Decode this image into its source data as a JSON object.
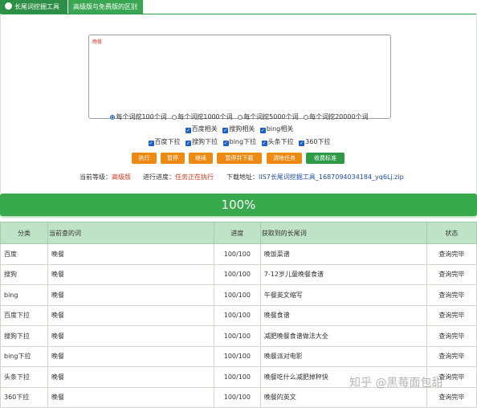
{
  "tabs": [
    {
      "label": "长尾词挖掘工具"
    },
    {
      "label": "高级版与免费版的区别"
    }
  ],
  "keyword_input": {
    "value": "晚餐"
  },
  "radio_options": [
    {
      "label": "每个词挖100个词",
      "checked": true
    },
    {
      "label": "每个词挖1000个词",
      "checked": false
    },
    {
      "label": "每个词挖5000个词",
      "checked": false
    },
    {
      "label": "每个词挖20000个词",
      "checked": false
    }
  ],
  "related_checks": [
    {
      "label": "百度相关",
      "checked": true
    },
    {
      "label": "搜狗相关",
      "checked": true
    },
    {
      "label": "bing相关",
      "checked": true
    }
  ],
  "dropdown_checks": [
    {
      "label": "百度下拉",
      "checked": true
    },
    {
      "label": "搜狗下拉",
      "checked": true
    },
    {
      "label": "bing下拉",
      "checked": true
    },
    {
      "label": "头条下拉",
      "checked": true
    },
    {
      "label": "360下拉",
      "checked": true
    }
  ],
  "buttons": {
    "execute": "执行",
    "pause": "暂停",
    "continue": "继续",
    "pause_download": "暂停并下载",
    "clear": "清除任务",
    "pricing": "收费标准"
  },
  "status": {
    "level_label": "当前等级：",
    "level_value": "高级版",
    "progress_label": "进行进度：",
    "progress_value": "任务正在执行",
    "download_label": "下载地址：",
    "download_link": "IIS7长尾词挖掘工具_1687094034184_yq6Lj.zip"
  },
  "progress_bar": {
    "text": "100%",
    "percent": 100,
    "color": "#39a94d"
  },
  "table": {
    "headers": [
      "分类",
      "当前查的词",
      "进度",
      "获取到的长尾词",
      "状态"
    ],
    "rows": [
      [
        "百度",
        "晚餐",
        "100/100",
        "晚饭菜谱",
        "查询完毕"
      ],
      [
        "搜狗",
        "晚餐",
        "100/100",
        "7-12岁儿童晚餐食谱",
        "查询完毕"
      ],
      [
        "bing",
        "晚餐",
        "100/100",
        "午餐英文缩写",
        "查询完毕"
      ],
      [
        "百度下拉",
        "晚餐",
        "100/100",
        "晚餐食谱",
        "查询完毕"
      ],
      [
        "搜狗下拉",
        "晚餐",
        "100/100",
        "减肥晚餐食谱做法大全",
        "查询完毕"
      ],
      [
        "bing下拉",
        "晚餐",
        "100/100",
        "晚餐派对电影",
        "查询完毕"
      ],
      [
        "头条下拉",
        "晚餐",
        "100/100",
        "晚餐吃什么减肥掉秤快",
        "查询完毕"
      ],
      [
        "360下拉",
        "晚餐",
        "100/100",
        "晚餐的英文",
        "查询完毕"
      ]
    ]
  },
  "watermark": "知乎 @黑莓面包甜"
}
